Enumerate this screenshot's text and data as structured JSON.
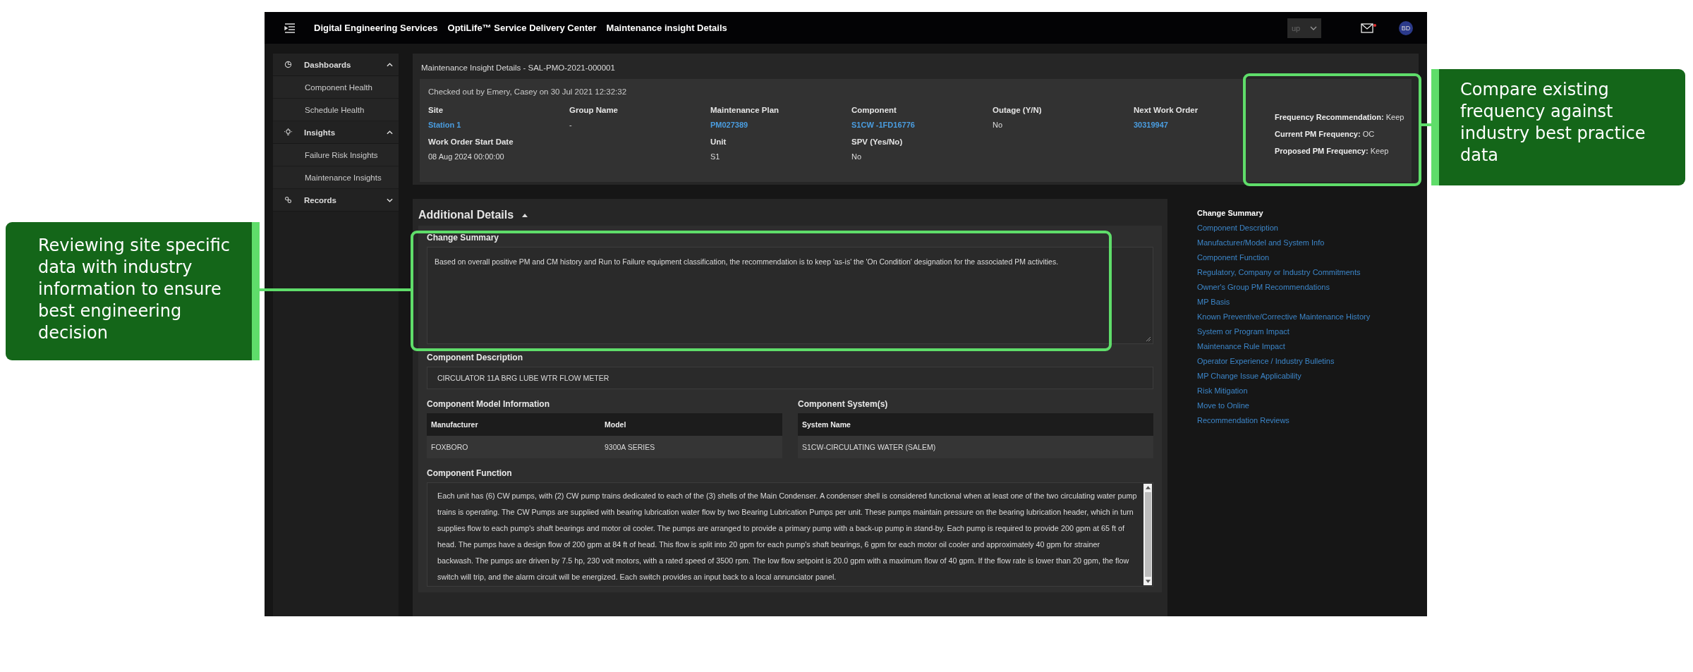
{
  "top_bar": {
    "titles": [
      "Digital Engineering Services",
      "OptiLife™ Service Delivery Center",
      "Maintenance insight Details"
    ],
    "dropdown_value": "up",
    "mail_unread": true,
    "avatar": "BD"
  },
  "sidebar": [
    {
      "label": "Dashboards",
      "expanded": true,
      "children": [
        {
          "label": "Component Health"
        },
        {
          "label": "Schedule Health"
        }
      ]
    },
    {
      "label": "Insights",
      "expanded": true,
      "children": [
        {
          "label": "Failure Risk Insights"
        },
        {
          "label": "Maintenance Insights"
        }
      ]
    },
    {
      "label": "Records",
      "expanded": false
    }
  ],
  "details": {
    "title": "Maintenance Insight Details - SAL-PMO-2021-000001",
    "checked_out": "Checked out by Emery, Casey on 30 Jul 2021 12:32:32",
    "columns": [
      [
        {
          "label": "Site",
          "value": "Station 1",
          "link": true
        },
        {
          "label": "Work Order Start Date",
          "value": "08 Aug 2024 00:00:00",
          "link": false
        }
      ],
      [
        {
          "label": "Group Name",
          "value": "-",
          "link": false
        }
      ],
      [
        {
          "label": "Maintenance Plan",
          "value": "PM027389",
          "link": true
        },
        {
          "label": "Unit",
          "value": "S1",
          "link": false
        }
      ],
      [
        {
          "label": "Component",
          "value": "S1CW -1FD16776",
          "link": true
        },
        {
          "label": "SPV (Yes/No)",
          "value": "No",
          "link": false
        }
      ],
      [
        {
          "label": "Outage (Y/N)",
          "value": "No",
          "link": false
        }
      ],
      [
        {
          "label": "Next Work Order",
          "value": "30319947",
          "link": true
        }
      ]
    ],
    "frequency": [
      "**Frequency Recommendation:** Keep",
      "**Current PM Frequency:** OC",
      "**Proposed PM Frequency:** Keep"
    ]
  },
  "additional": {
    "heading": "Additional Details",
    "expanded": true,
    "change_summary": {
      "label": "Change Summary",
      "text": "Based on overall positive PM and CM history and Run to Failure equipment classification, the recommendation is to keep 'as-is' the 'On Condition' designation for the associated PM activities."
    },
    "component_description": {
      "label": "Component Description",
      "value": "CIRCULATOR 11A BRG LUBE WTR FLOW METER"
    },
    "model_info": {
      "label": "Component Model Information",
      "columns": [
        "Manufacturer",
        "Model"
      ],
      "rows": [
        [
          "FOXBORO",
          "9300A SERIES"
        ]
      ]
    },
    "systems": {
      "label": "Component System(s)",
      "columns": [
        "System Name"
      ],
      "rows": [
        [
          "S1CW-CIRCULATING WATER (SALEM)"
        ]
      ]
    },
    "component_function": {
      "label": "Component Function",
      "text": "Each unit has (6) CW pumps, with (2) CW pump trains dedicated to each of the (3) shells of the Main Condenser. A condenser shell is considered functional when at least one of the two circulating water pump trains is operating. The CW Pumps are supplied with bearing lubrication water flow by two Bearing Lubrication Pumps per unit. These pumps maintain pressure on the bearing lubrication header, which in turn supplies flow to each pump's shaft bearings and motor oil cooler. The pumps are arranged to provide a primary pump with a back-up pump in stand-by. Each pump is required to provide 200 gpm at 65 ft of head. The pumps have a design flow of 200 gpm at 84 ft of head. This flow is split into 20 gpm for each pump's shaft bearings, 6 gpm for each motor oil cooler and approximately 40 gpm for strainer backwash. The pumps are driven by 7.5 hp, 230 volt motors, with a rated speed of 3500 rpm. The low flow setpoint is 20.0 gpm with a maximum flow of 40 gpm. If the flow rate is lower than 20 gpm, the flow switch will trip, and the alarm circuit will be energized. Each switch provides an input back to a local annunciator panel."
    }
  },
  "section_nav": [
    {
      "label": "Change Summary",
      "selected": true
    },
    {
      "label": "Component Description",
      "selected": false
    },
    {
      "label": "Manufacturer/Model and System Info",
      "selected": false
    },
    {
      "label": "Component Function",
      "selected": false
    },
    {
      "label": "Regulatory, Company or Industry Commitments",
      "selected": false
    },
    {
      "label": "Owner's Group PM Recommendations",
      "selected": false
    },
    {
      "label": "MP Basis",
      "selected": false
    },
    {
      "label": "Known Preventive/Corrective Maintenance History",
      "selected": false
    },
    {
      "label": "System or Program Impact",
      "selected": false
    },
    {
      "label": "Maintenance Rule Impact",
      "selected": false
    },
    {
      "label": "Operator Experience / Industry Bulletins",
      "selected": false
    },
    {
      "label": "MP Change Issue Applicability",
      "selected": false
    },
    {
      "label": "Risk Mitigation",
      "selected": false
    },
    {
      "label": "Move to Online",
      "selected": false
    },
    {
      "label": "Recommendation Reviews",
      "selected": false
    }
  ],
  "callouts": [
    {
      "text": "Compare existing frequency against industry best practice data",
      "kind": "right"
    },
    {
      "text": "Reviewing site specific data with industry information to ensure best engineering decision",
      "kind": "left"
    }
  ]
}
